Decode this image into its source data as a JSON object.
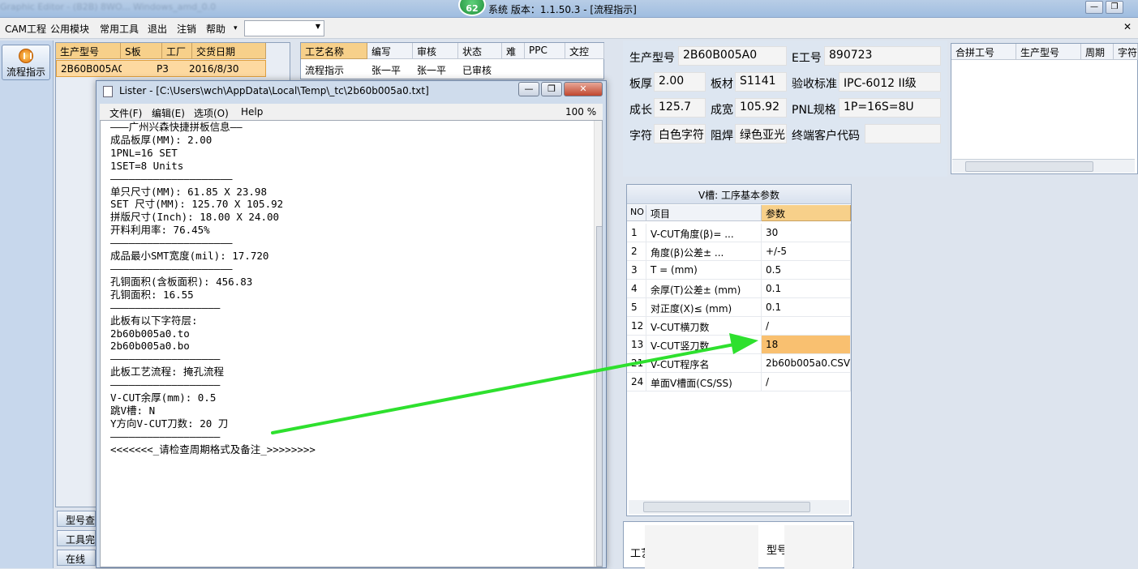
{
  "app": {
    "title": "系统  版本：1.1.50.3 - [流程指示]",
    "badge": "62",
    "blurred_title": "Graphic Editor - (B2B) 8WO... Windows_amd_0.0"
  },
  "menu": {
    "items": [
      "CAM工程",
      "公用模块",
      "常用工具",
      "退出",
      "注销",
      "帮助"
    ],
    "help_caret": "▾",
    "combo_value": ""
  },
  "sidebar": {
    "flow_button": "流程指示"
  },
  "grid1": {
    "headers": [
      "生产型号",
      "S板",
      "工厂",
      "交货日期"
    ],
    "row": [
      "2B60B005A0",
      "",
      "P3",
      "2016/8/30"
    ]
  },
  "grid2": {
    "headers": [
      "工艺名称",
      "编写",
      "审核",
      "状态",
      "难",
      "PPC",
      "文控"
    ],
    "row": [
      "流程指示",
      "张一平",
      "张一平",
      "已审核",
      "",
      "",
      ""
    ]
  },
  "bottom_tabs": [
    "型号查",
    "工具完",
    "在线"
  ],
  "lister": {
    "title": "Lister - [C:\\Users\\wch\\AppData\\Local\\Temp\\_tc\\2b60b005a0.txt]",
    "menu": [
      "文件(F)",
      "编辑(E)",
      "选项(O)",
      "Help"
    ],
    "zoom": "100 %",
    "lines": [
      "———广州兴森快捷拼板信息——",
      "成品板厚(MM): 2.00",
      "1PNL=16 SET",
      "1SET=8 Units",
      "————————————————————",
      "单只尺寸(MM): 61.85 X 23.98",
      "SET 尺寸(MM): 125.70 X 105.92",
      "拼版尺寸(Inch): 18.00 X 24.00",
      "开料利用率: 76.45%",
      "————————————————————",
      "成品最小SMT宽度(mil): 17.720",
      "————————————————————",
      "孔铜面积(含板面积): 456.83",
      "孔铜面积: 16.55",
      "——————————————————",
      "此板有以下字符层:",
      "2b60b005a0.to",
      "2b60b005a0.bo",
      "——————————————————",
      "此板工艺流程: 掩孔流程",
      "——————————————————",
      "V-CUT余厚(mm): 0.5",
      "跳V槽: N",
      "Y方向V-CUT刀数: 20 刀",
      "——————————————————",
      "<<<<<<<_请检查周期格式及备注_>>>>>>>>"
    ]
  },
  "info": {
    "prod_model_label": "生产型号",
    "prod_model": "2B60B005A0",
    "e_no_label": "E工号",
    "e_no": "890723",
    "thickness_label": "板厚",
    "thickness": "2.00",
    "material_label": "板材",
    "material": "S1141",
    "standard_label": "验收标准",
    "standard": "IPC-6012 II级",
    "length_label": "成长",
    "length": "125.7",
    "width_label": "成宽",
    "width": "105.92",
    "pnl_label": "PNL规格",
    "pnl": "1P=16S=8U",
    "char_label": "字符",
    "char": "白色字符",
    "mask_label": "阻焊",
    "mask": "绿色亚光",
    "customer_label": "终端客户代码",
    "customer": ""
  },
  "merge_grid": {
    "headers": [
      "合拼工号",
      "生产型号",
      "周期",
      "字符"
    ]
  },
  "vcut": {
    "title": "V槽: 工序基本参数",
    "headers": [
      "NO",
      "项目",
      "参数"
    ],
    "rows": [
      {
        "no": "1",
        "item": "V-CUT角度(β)=  ...",
        "value": "30"
      },
      {
        "no": "2",
        "item": "角度(β)公差±  ...",
        "value": "+/-5"
      },
      {
        "no": "3",
        "item": "T =  (mm)",
        "value": "0.5"
      },
      {
        "no": "4",
        "item": "余厚(T)公差±  (mm)",
        "value": "0.1"
      },
      {
        "no": "5",
        "item": "对正度(X)≤ (mm)",
        "value": "0.1"
      },
      {
        "no": "12",
        "item": "V-CUT横刀数",
        "value": "/"
      },
      {
        "no": "13",
        "item": "V-CUT竖刀数",
        "value": "18"
      },
      {
        "no": "21",
        "item": "V-CUT程序名",
        "value": "2b60b005a0.CSV"
      },
      {
        "no": "24",
        "item": "单面V槽面(CS/SS)",
        "value": "/"
      }
    ],
    "highlight_row_index": 6
  },
  "bottom_panel": {
    "label1": "工艺",
    "label2": "型号"
  },
  "colors": {
    "arrow": "#2ee02e",
    "highlight": "#f9c070",
    "header": "#f7d08a"
  }
}
